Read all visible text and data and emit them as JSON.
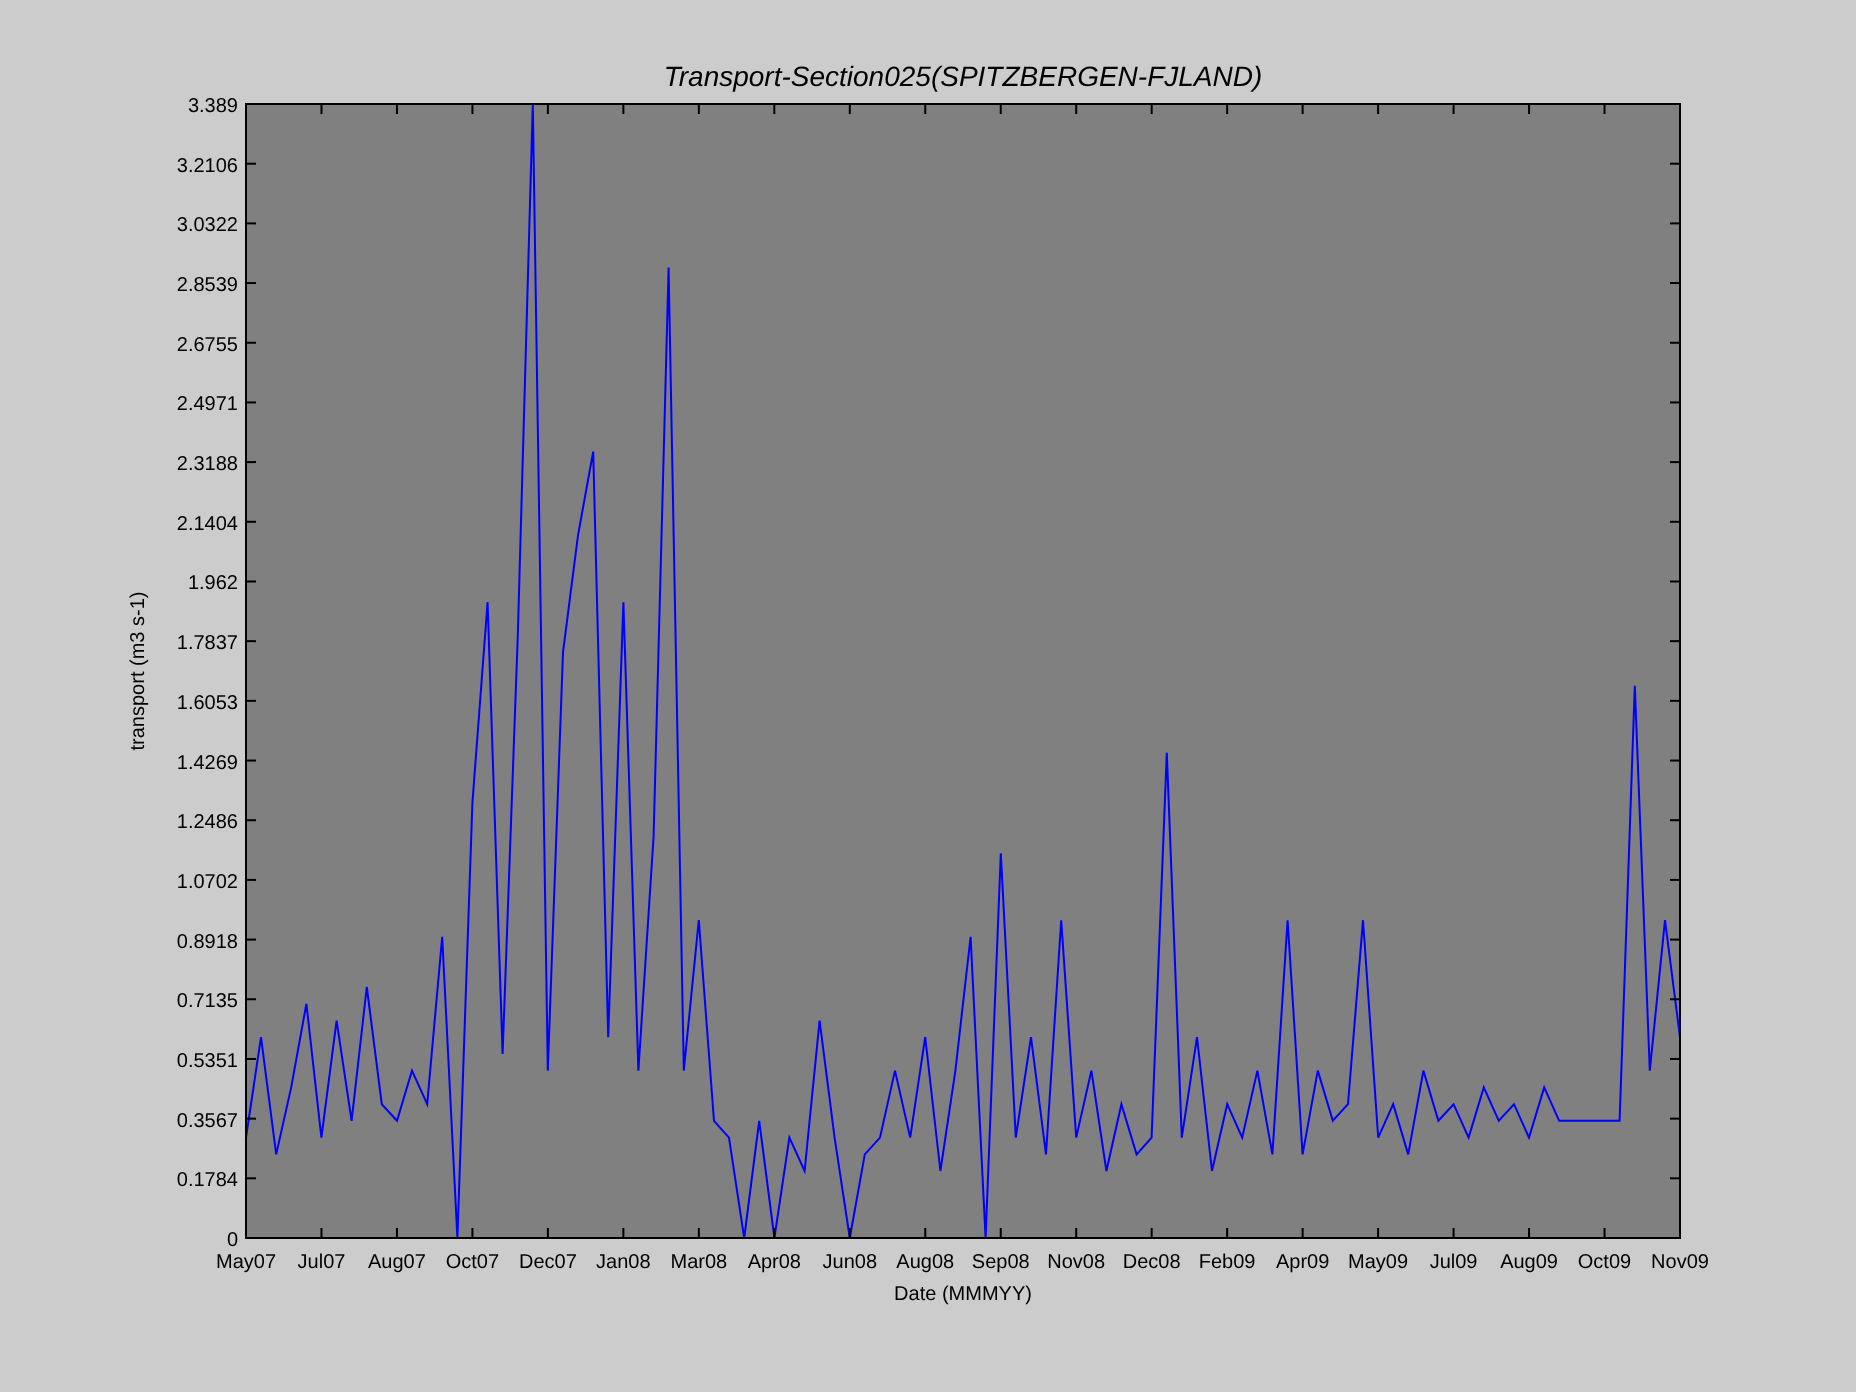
{
  "figure": {
    "chart_data": {
      "type": "line",
      "title": "Transport-Section025(SPITZBERGEN-FJLAND)",
      "xlabel": "Date (MMMYY)",
      "ylabel": "transport (m3 s-1)",
      "categories": [
        "May07",
        null,
        null,
        null,
        null,
        "Jul07",
        null,
        null,
        null,
        null,
        "Aug07",
        null,
        null,
        null,
        null,
        "Oct07",
        null,
        null,
        null,
        null,
        "Dec07",
        null,
        null,
        null,
        null,
        "Jan08",
        null,
        null,
        null,
        null,
        "Mar08",
        null,
        null,
        null,
        null,
        "Apr08",
        null,
        null,
        null,
        null,
        "Jun08",
        null,
        null,
        null,
        null,
        "Aug08",
        null,
        null,
        null,
        null,
        "Sep08",
        null,
        null,
        null,
        null,
        "Nov08",
        null,
        null,
        null,
        null,
        "Dec08",
        null,
        null,
        null,
        null,
        "Feb09",
        null,
        null,
        null,
        null,
        "Apr09",
        null,
        null,
        null,
        null,
        "May09",
        null,
        null,
        null,
        null,
        "Jul09",
        null,
        null,
        null,
        null,
        "Aug09",
        null,
        null,
        null,
        null,
        "Oct09",
        null,
        null,
        null,
        null,
        "Nov09"
      ],
      "series": [
        {
          "color": "#0000ff",
          "values": [
            0.3,
            0.6,
            0.25,
            0.45,
            0.7,
            0.3,
            0.65,
            0.35,
            0.75,
            0.4,
            0.35,
            0.5,
            0.4,
            0.9,
            0,
            1.3,
            1.9,
            0.55,
            1.8,
            3.389,
            0.5,
            1.75,
            2.1,
            2.35,
            0.6,
            1.9,
            0.5,
            1.2,
            2.9,
            0.5,
            0.95,
            0.35,
            0.3,
            0,
            0.35,
            0,
            0.3,
            0.2,
            0.65,
            0.3,
            0,
            0.25,
            0.3,
            0.5,
            0.3,
            0.6,
            0.2,
            0.5,
            0.9,
            0,
            1.15,
            0.3,
            0.6,
            0.25,
            0.95,
            0.3,
            0.5,
            0.2,
            0.4,
            0.25,
            0.3,
            1.45,
            0.3,
            0.6,
            0.2,
            0.4,
            0.3,
            0.5,
            0.25,
            0.95,
            0.25,
            0.5,
            0.35,
            0.4,
            0.95,
            0.3,
            0.4,
            0.25,
            0.5,
            0.35,
            0.4,
            0.3,
            0.45,
            0.35,
            0.4,
            0.3,
            0.45,
            0.35,
            0.35,
            0.35,
            0.35,
            0.35,
            1.65,
            0.5,
            0.95,
            0.6
          ]
        }
      ],
      "ylim": [
        0,
        3.389
      ],
      "yticks": [
        0,
        0.1784,
        0.3567,
        0.5351,
        0.7135,
        0.8918,
        1.0702,
        1.2486,
        1.4269,
        1.6053,
        1.7837,
        1.962,
        2.1404,
        2.3188,
        2.4971,
        2.6755,
        2.8539,
        3.0322,
        3.2106,
        3.389
      ]
    }
  }
}
